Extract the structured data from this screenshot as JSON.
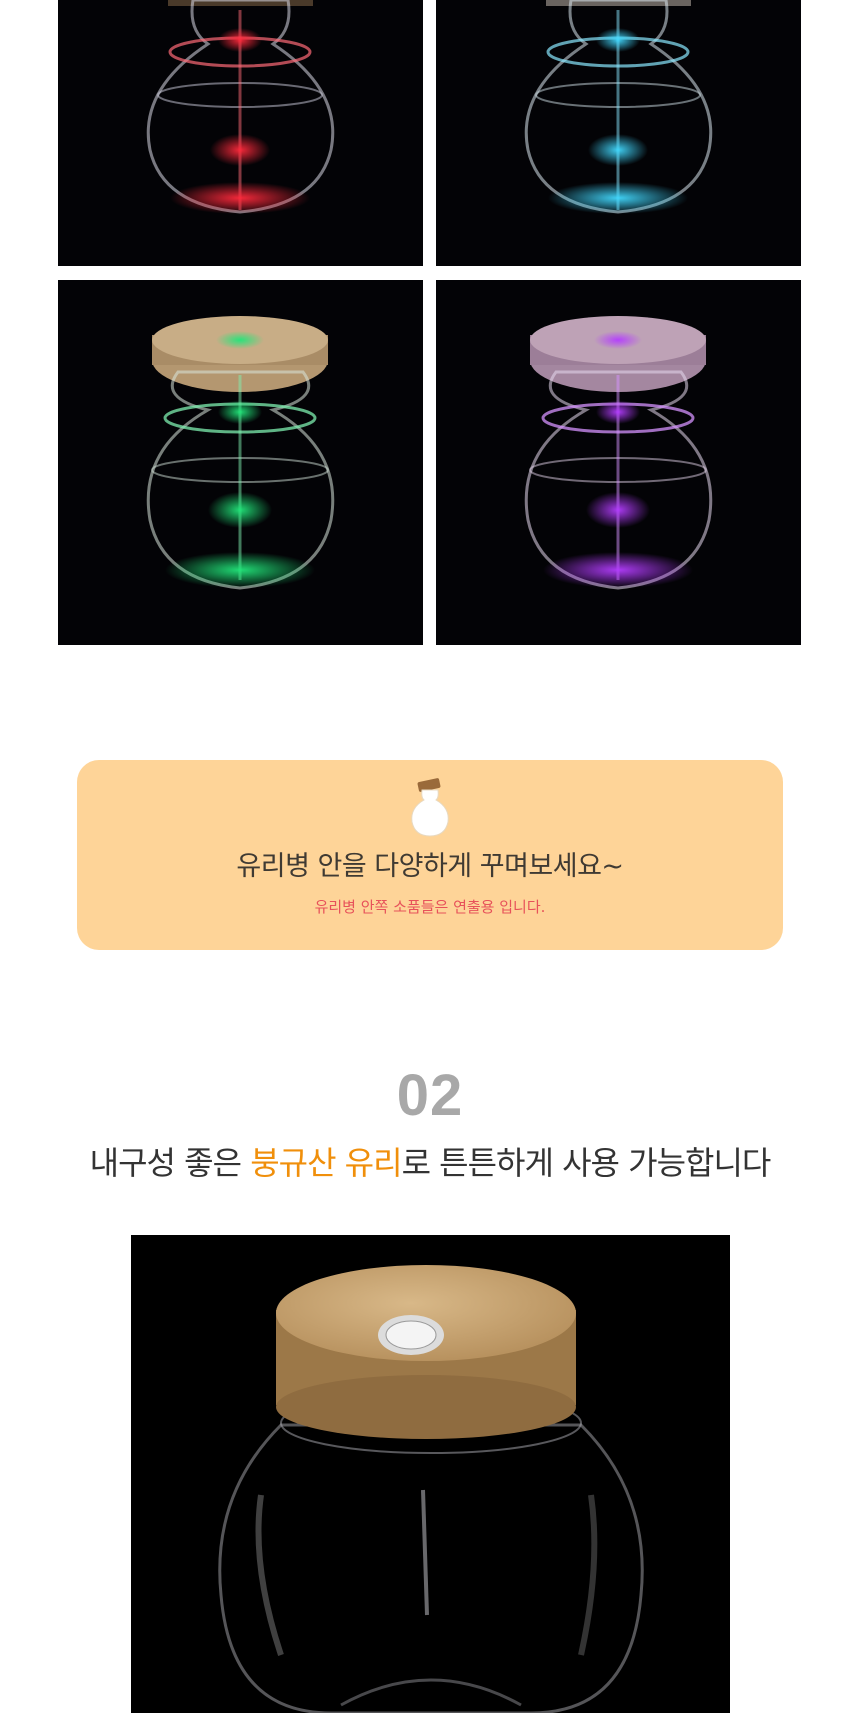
{
  "gallery": {
    "tiles": [
      {
        "name": "red",
        "glow": "#ff2a3c"
      },
      {
        "name": "cyan",
        "glow": "#42d9ff"
      },
      {
        "name": "green",
        "glow": "#22e67a"
      },
      {
        "name": "purple",
        "glow": "#b43dff"
      }
    ]
  },
  "notice": {
    "title": "유리병 안을 다양하게 꾸며보세요~",
    "subtitle": "유리병 안쪽 소품들은 연출용 입니다.",
    "background": "#fed498"
  },
  "section": {
    "number": "02",
    "heading_pre": "내구성 좋은 ",
    "heading_highlight": "붕규산 유리",
    "heading_post": "로 튼튼하게 사용 가능합니다",
    "highlight_color": "#f08f0b"
  }
}
